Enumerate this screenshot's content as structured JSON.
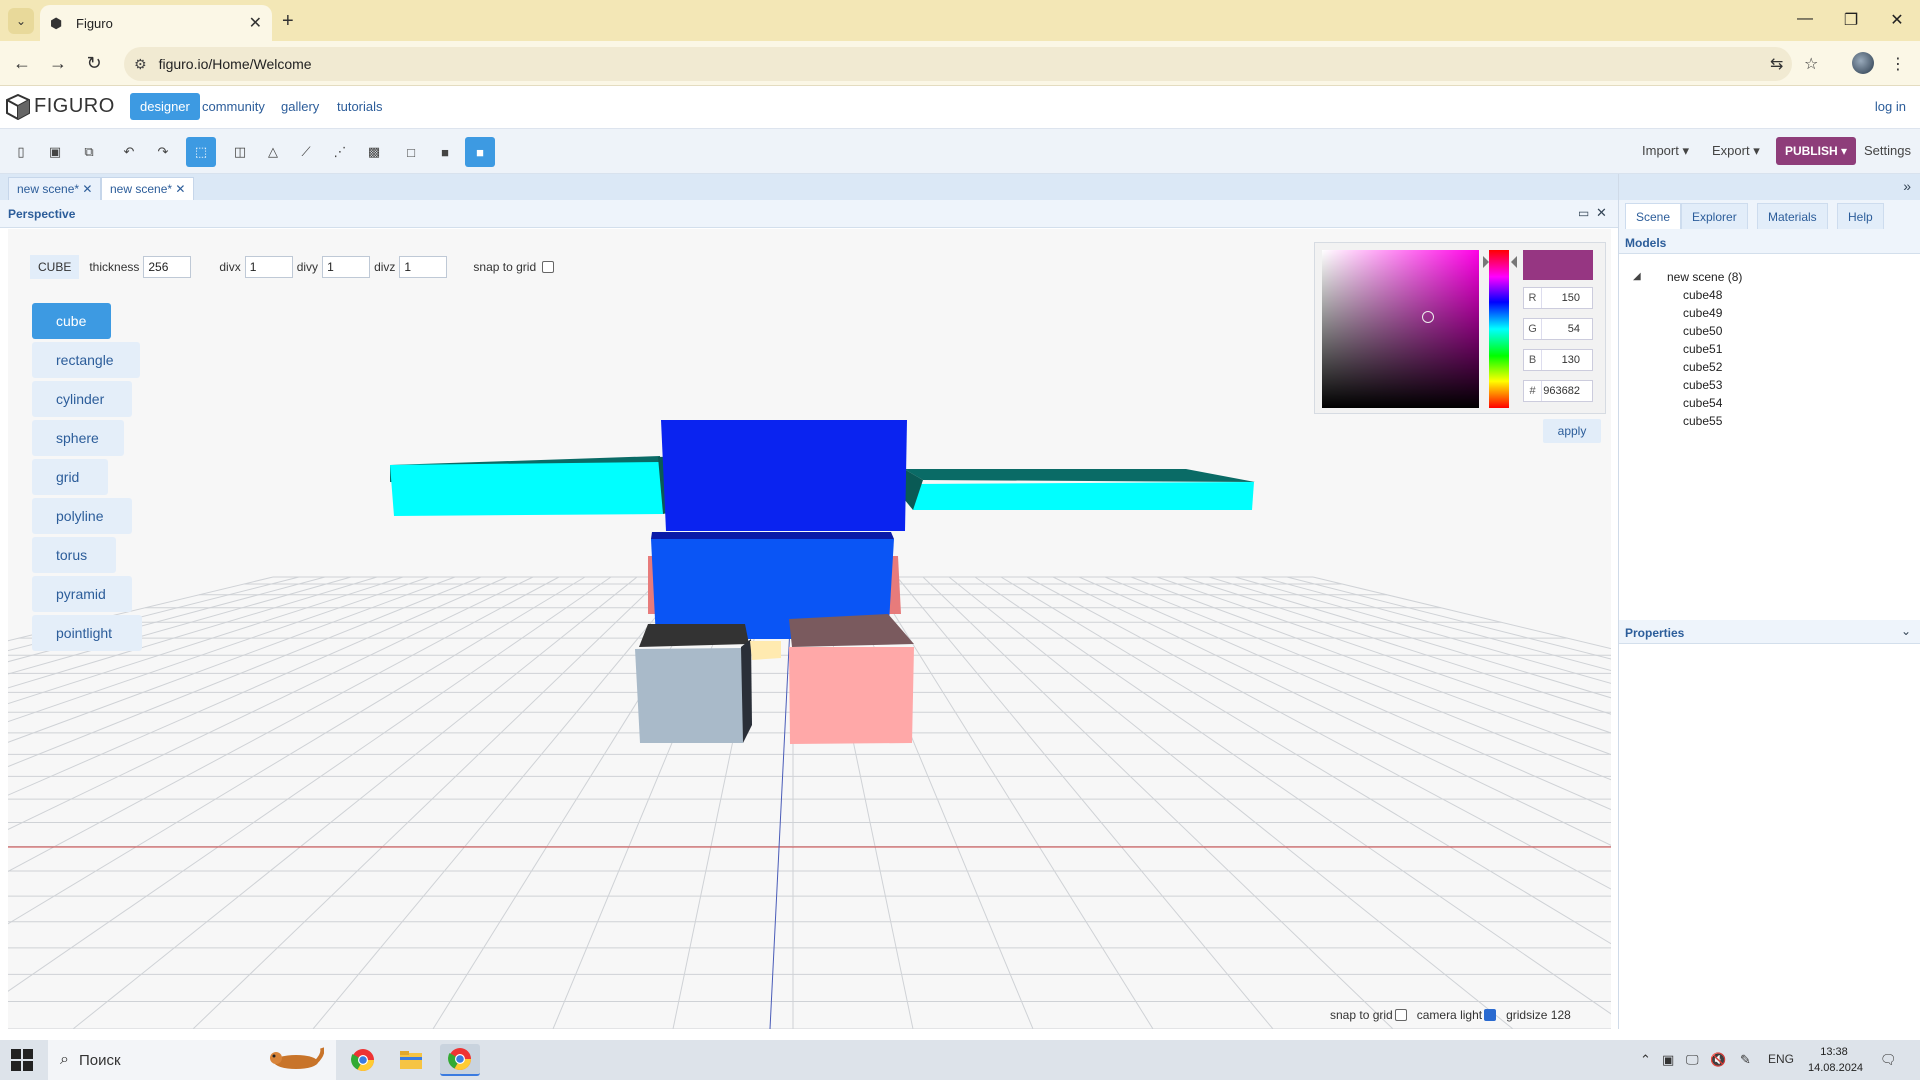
{
  "browser": {
    "tab_title": "Figuro",
    "url": "figuro.io/Home/Welcome"
  },
  "app": {
    "logo_text": "FIGURO",
    "nav": [
      "designer",
      "community",
      "gallery",
      "tutorials"
    ],
    "login": "log in"
  },
  "toolbar": {
    "import": "Import",
    "export": "Export",
    "publish": "PUBLISH",
    "settings": "Settings"
  },
  "scene_tabs": [
    "new scene*",
    "new scene*"
  ],
  "viewport": {
    "title": "Perspective",
    "options": {
      "type": "CUBE",
      "thickness_label": "thickness",
      "thickness": "256",
      "divx_label": "divx",
      "divx": "1",
      "divy_label": "divy",
      "divy": "1",
      "divz_label": "divz",
      "divz": "1",
      "snap_label": "snap to grid"
    },
    "primitives": [
      "cube",
      "rectangle",
      "cylinder",
      "sphere",
      "grid",
      "polyline",
      "torus",
      "pyramid",
      "pointlight"
    ],
    "status": {
      "snap_label": "snap to grid",
      "camera_label": "camera light",
      "gridsize_label": "gridsize",
      "gridsize": "128"
    }
  },
  "color_picker": {
    "color": "#963682",
    "r_label": "R",
    "r": "150",
    "g_label": "G",
    "g": "54",
    "b_label": "B",
    "b": "130",
    "hex_label": "#",
    "hex": "963682",
    "apply": "apply"
  },
  "right_panel": {
    "tabs": [
      "Scene",
      "Explorer",
      "Materials",
      "Help"
    ],
    "models_title": "Models",
    "scene_node": "new scene (8)",
    "models": [
      "cube48",
      "cube49",
      "cube50",
      "cube51",
      "cube52",
      "cube53",
      "cube54",
      "cube55"
    ],
    "properties_title": "Properties"
  },
  "taskbar": {
    "search": "Поиск",
    "lang": "ENG",
    "time": "13:38",
    "date": "14.08.2024"
  },
  "colors": {
    "accent": "#3d9ae2",
    "publish": "#8e3d7a",
    "cyan": "#00ffff",
    "blue": "#0020f0",
    "pink": "#ffaaaa",
    "grey": "#a8b8c8"
  }
}
